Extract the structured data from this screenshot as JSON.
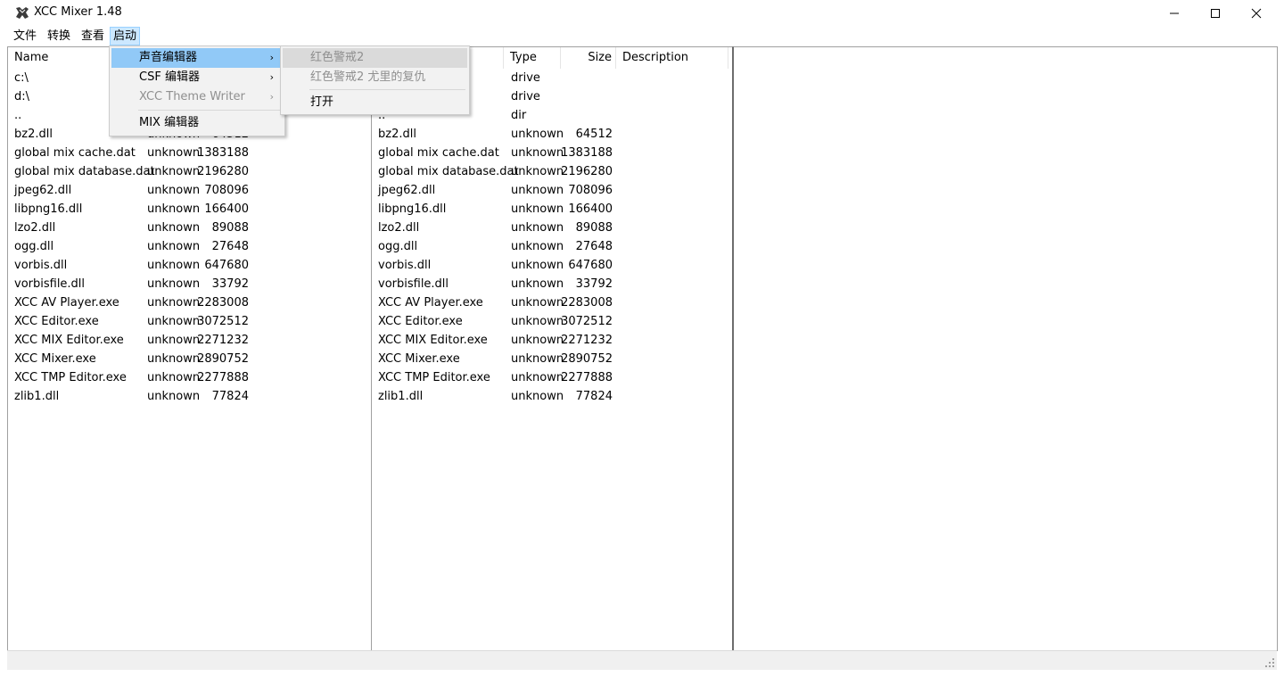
{
  "window": {
    "title": "XCC Mixer 1.48"
  },
  "menubar": [
    "文件",
    "转换",
    "查看",
    "启动"
  ],
  "columns": {
    "name": "Name",
    "type": "Type",
    "size": "Size",
    "description": "Description"
  },
  "left_pane": {
    "rows": [
      {
        "name": "c:\\",
        "type": "",
        "size": ""
      },
      {
        "name": "d:\\",
        "type": "",
        "size": ""
      },
      {
        "name": "..",
        "type": "",
        "size": ""
      },
      {
        "name": "bz2.dll",
        "type": "unknown",
        "size": "64512"
      },
      {
        "name": "global mix cache.dat",
        "type": "unknown",
        "size": "1383188"
      },
      {
        "name": "global mix database.dat",
        "type": "unknown",
        "size": "2196280"
      },
      {
        "name": "jpeg62.dll",
        "type": "unknown",
        "size": "708096"
      },
      {
        "name": "libpng16.dll",
        "type": "unknown",
        "size": "166400"
      },
      {
        "name": "lzo2.dll",
        "type": "unknown",
        "size": "89088"
      },
      {
        "name": "ogg.dll",
        "type": "unknown",
        "size": "27648"
      },
      {
        "name": "vorbis.dll",
        "type": "unknown",
        "size": "647680"
      },
      {
        "name": "vorbisfile.dll",
        "type": "unknown",
        "size": "33792"
      },
      {
        "name": "XCC AV Player.exe",
        "type": "unknown",
        "size": "2283008"
      },
      {
        "name": "XCC Editor.exe",
        "type": "unknown",
        "size": "3072512"
      },
      {
        "name": "XCC MIX Editor.exe",
        "type": "unknown",
        "size": "2271232"
      },
      {
        "name": "XCC Mixer.exe",
        "type": "unknown",
        "size": "2890752"
      },
      {
        "name": "XCC TMP Editor.exe",
        "type": "unknown",
        "size": "2277888"
      },
      {
        "name": "zlib1.dll",
        "type": "unknown",
        "size": "77824"
      }
    ]
  },
  "mid_pane": {
    "rows": [
      {
        "name": "",
        "type": "drive",
        "size": ""
      },
      {
        "name": "",
        "type": "drive",
        "size": ""
      },
      {
        "name": "..",
        "type": "dir",
        "size": ""
      },
      {
        "name": "bz2.dll",
        "type": "unknown",
        "size": "64512"
      },
      {
        "name": "global mix cache.dat",
        "type": "unknown",
        "size": "1383188"
      },
      {
        "name": "global mix database.dat",
        "type": "unknown",
        "size": "2196280"
      },
      {
        "name": "jpeg62.dll",
        "type": "unknown",
        "size": "708096"
      },
      {
        "name": "libpng16.dll",
        "type": "unknown",
        "size": "166400"
      },
      {
        "name": "lzo2.dll",
        "type": "unknown",
        "size": "89088"
      },
      {
        "name": "ogg.dll",
        "type": "unknown",
        "size": "27648"
      },
      {
        "name": "vorbis.dll",
        "type": "unknown",
        "size": "647680"
      },
      {
        "name": "vorbisfile.dll",
        "type": "unknown",
        "size": "33792"
      },
      {
        "name": "XCC AV Player.exe",
        "type": "unknown",
        "size": "2283008"
      },
      {
        "name": "XCC Editor.exe",
        "type": "unknown",
        "size": "3072512"
      },
      {
        "name": "XCC MIX Editor.exe",
        "type": "unknown",
        "size": "2271232"
      },
      {
        "name": "XCC Mixer.exe",
        "type": "unknown",
        "size": "2890752"
      },
      {
        "name": "XCC TMP Editor.exe",
        "type": "unknown",
        "size": "2277888"
      },
      {
        "name": "zlib1.dll",
        "type": "unknown",
        "size": "77824"
      }
    ]
  },
  "launch_menu": {
    "items": [
      {
        "label": "声音编辑器",
        "submenu": true,
        "highlighted": true,
        "disabled": false
      },
      {
        "label": "CSF 编辑器",
        "submenu": true,
        "highlighted": false,
        "disabled": false
      },
      {
        "label": "XCC Theme Writer",
        "submenu": true,
        "highlighted": false,
        "disabled": true
      },
      {
        "label": "MIX 编辑器",
        "submenu": false,
        "highlighted": false,
        "disabled": false
      }
    ],
    "submenu_arrow": "›"
  },
  "sound_editor_submenu": {
    "items": [
      {
        "label": "红色警戒2",
        "disabled": true
      },
      {
        "label": "红色警戒2  尤里的复仇",
        "disabled": true
      },
      {
        "label": "打开",
        "disabled": false
      }
    ]
  },
  "colors": {
    "menu_highlight": "#91c9f7",
    "active_menu_bg": "#cce8ff"
  }
}
